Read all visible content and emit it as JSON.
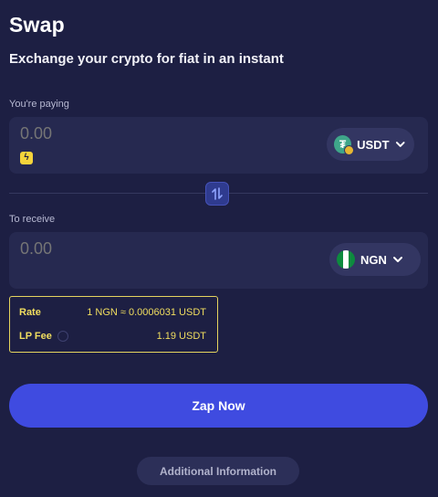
{
  "header": {
    "title": "Swap",
    "subtitle": "Exchange your crypto for fiat in an instant"
  },
  "paying": {
    "label": "You're paying",
    "placeholder": "0.00",
    "currency": "USDT",
    "currency_icon": "usdt-coin-icon"
  },
  "receive": {
    "label": "To receive",
    "placeholder": "0.00",
    "currency": "NGN",
    "currency_icon": "nigeria-flag-icon"
  },
  "rate": {
    "rate_label": "Rate",
    "rate_value": "1 NGN ≈ 0.0006031 USDT",
    "fee_label": "LP Fee",
    "fee_value": "1.19 USDT"
  },
  "actions": {
    "zap_label": "Zap Now",
    "info_label": "Additional Information"
  },
  "colors": {
    "background": "#1d1f43",
    "panel": "#262950",
    "accent": "#3f4be0",
    "rate_border": "#e4d45e",
    "usdt_green": "#3fa68a",
    "ngn_green": "#0d8a3e"
  }
}
